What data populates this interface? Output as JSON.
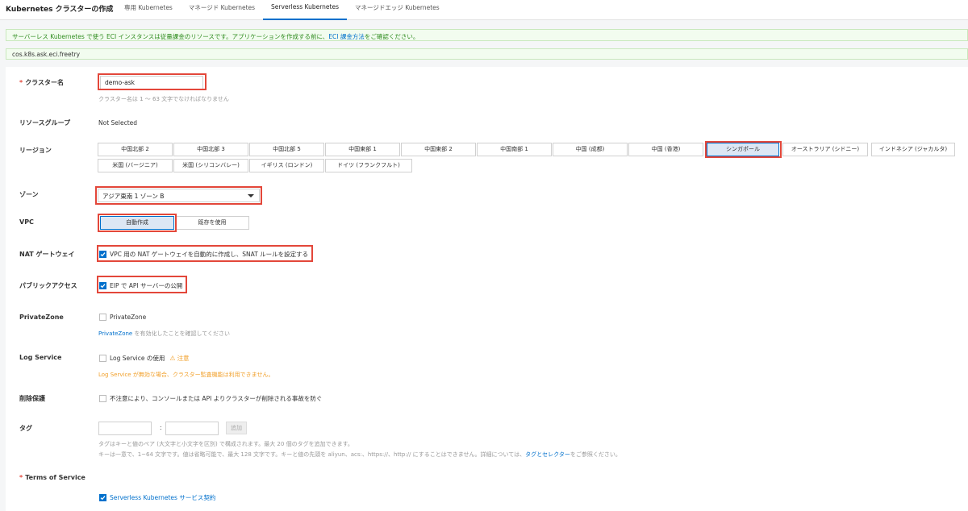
{
  "header": {
    "title": "Kubernetes クラスターの作成",
    "tabs": [
      {
        "label": "専用 Kubernetes",
        "active": false
      },
      {
        "label": "マネージド Kubernetes",
        "active": false
      },
      {
        "label": "Serverless Kubernetes",
        "active": true
      },
      {
        "label": "マネージドエッジ Kubernetes",
        "active": false
      }
    ]
  },
  "notices": {
    "billing_pre": "サーバーレス Kubernetes で使う ECI インスタンスは従量課金のリソースです。アプリケーションを作成する前に、",
    "billing_link": "ECI 課金方法",
    "billing_post": "をご確認ください。",
    "feature_flag": "cos.k8s.ask.eci.freetry"
  },
  "form": {
    "cluster_name": {
      "label": "クラスター名",
      "value": "demo-ask",
      "help": "クラスター名は 1 ～ 63 文字でなければなりません"
    },
    "resource_group": {
      "label": "リソースグループ",
      "value": "Not Selected"
    },
    "region": {
      "label": "リージョン",
      "options": [
        "中国北部 2",
        "中国北部 3",
        "中国北部 5",
        "中国東部 1",
        "中国東部 2",
        "中国南部 1",
        "中国 (成都)",
        "中国 (香港)",
        "シンガポール",
        "オーストラリア (シドニー)",
        "インドネシア (ジャカルタ)",
        "米国 (バージニア)",
        "米国 (シリコンバレー)",
        "イギリス (ロンドン)",
        "ドイツ (フランクフルト)"
      ],
      "selected": "シンガポール"
    },
    "zone": {
      "label": "ゾーン",
      "value": "アジア東南 1 ゾーン B"
    },
    "vpc": {
      "label": "VPC",
      "options": [
        "自動作成",
        "既存を使用"
      ],
      "selected": "自動作成"
    },
    "nat": {
      "label": "NAT ゲートウェイ",
      "checkbox": "VPC 用の NAT ゲートウェイを自動的に作成し、SNAT ルールを設定する",
      "checked": true
    },
    "public_access": {
      "label": "パブリックアクセス",
      "checkbox": "EIP で API サーバーの公開",
      "checked": true
    },
    "private_zone": {
      "label": "PrivateZone",
      "checkbox": "PrivateZone",
      "checked": false,
      "help_link": "PrivateZone",
      "help_post": " を有効化したことを確認してください"
    },
    "log_service": {
      "label": "Log Service",
      "checkbox": "Log Service の使用",
      "checked": false,
      "warn_label": "注意",
      "warn": "Log Service が無効な場合、クラスター監査機能は利用できません。"
    },
    "deletion_protection": {
      "label": "削除保護",
      "checkbox": "不注意により、コンソールまたは API よりクラスターが削除される事故を防ぐ",
      "checked": false
    },
    "tags": {
      "label": "タグ",
      "separator": ":",
      "add_button": "追加",
      "help_line1": "タグはキーと値のペア (大文字と小文字を区別) で構成されます。最大 20 個のタグを追加できます。",
      "help_line2_pre": "キーは一意で、1~64 文字です。値は省略可能で、最大 128 文字です。キーと値の先頭を aliyun、acs:、https://、http:// にすることはできません。詳細については、",
      "help_line2_link": "タグとセレクター",
      "help_line2_post": "をご参照ください。"
    },
    "terms": {
      "label": "Terms of Service",
      "checkbox": "Serverless Kubernetes サービス契約",
      "checked": true
    }
  },
  "colors": {
    "accent": "#0070cc",
    "highlight": "#e3473a",
    "warning": "#f1a02b",
    "notice_green": "#2f8c1f"
  }
}
